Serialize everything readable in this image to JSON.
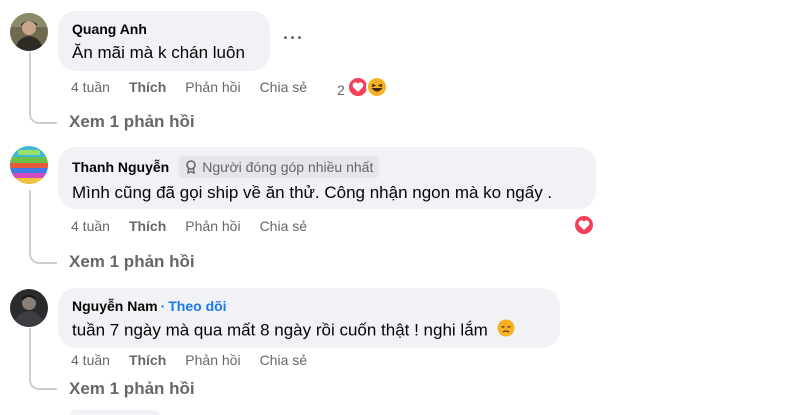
{
  "comments": [
    {
      "author": "Quang Anh",
      "text": "Ăn mãi mà k chán luôn",
      "time": "4 tuần",
      "like_label": "Thích",
      "reply_label": "Phản hồi",
      "share_label": "Chia sẻ",
      "reaction_count": "2",
      "reaction_icons": [
        "heart-icon",
        "laughing-emoji-icon"
      ],
      "view_replies": "Xem 1 phản hồi",
      "more_label": "···"
    },
    {
      "author": "Thanh Nguyễn",
      "badge": "Người đóng góp nhiều nhất",
      "text": "Mình cũng đã gọi ship về ăn thử. Công nhận ngon mà ko ngấy .",
      "time": "4 tuần",
      "like_label": "Thích",
      "reply_label": "Phản hồi",
      "share_label": "Chia sẻ",
      "reaction_icons": [
        "heart-icon"
      ],
      "view_replies": "Xem 1 phản hồi"
    },
    {
      "author": "Nguyễn Nam",
      "separator": "·",
      "follow_label": "Theo dõi",
      "text": "tuần 7 ngày mà qua mất 8 ngày rồi cuốn thật ! nghi lắm",
      "text_emoji": "disappointed-face-icon",
      "time": "4 tuần",
      "like_label": "Thích",
      "reply_label": "Phản hồi",
      "share_label": "Chia sẻ",
      "view_replies": "Xem 1 phản hồi"
    }
  ],
  "colors": {
    "bubble": "#f0f2f5",
    "secondary_text": "#65676b",
    "link": "#1877f2",
    "heart": "#f33e58",
    "thread_line": "#ccd0d5"
  }
}
